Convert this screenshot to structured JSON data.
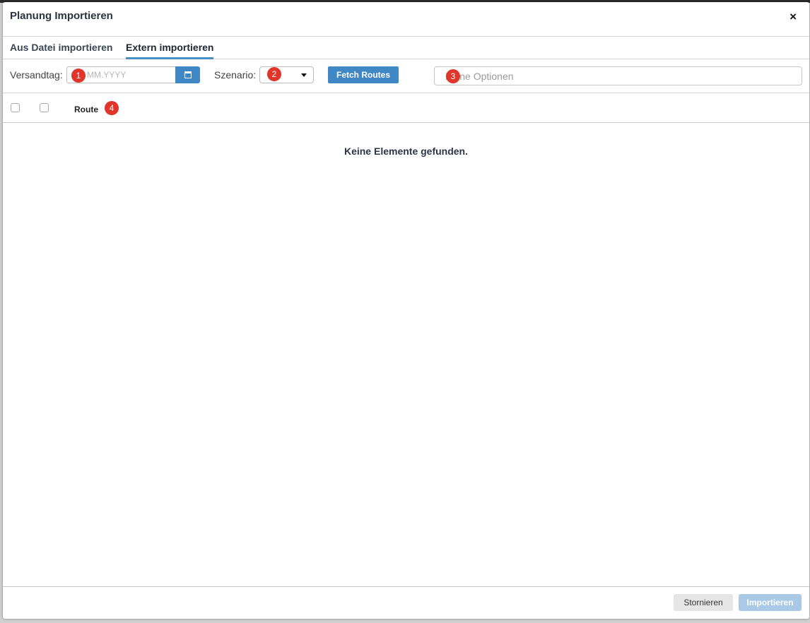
{
  "dialog": {
    "title": "Planung Importieren",
    "close_icon": "close-icon",
    "close_glyph": "×"
  },
  "tabs": [
    {
      "label": "Aus Datei importieren",
      "active": false
    },
    {
      "label": "Extern importieren",
      "active": true
    }
  ],
  "toolbar": {
    "versandtag_label": "Versandtag:",
    "date_placeholder": "MM.YYYY",
    "calendar_icon": "calendar-icon",
    "szenario_label": "Szenario:",
    "szenario_value": "",
    "fetch_button_label": "Fetch Routes",
    "options_placeholder": "Keine Optionen"
  },
  "markers": [
    "1",
    "2",
    "3",
    "4"
  ],
  "table": {
    "columns": [
      "Route"
    ],
    "empty_message": "Keine Elemente gefunden."
  },
  "footer": {
    "cancel_label": "Stornieren",
    "import_label": "Importieren"
  },
  "colors": {
    "accent": "#3f87c5",
    "marker": "#e0352b",
    "import_disabled": "#a9c9e6"
  }
}
